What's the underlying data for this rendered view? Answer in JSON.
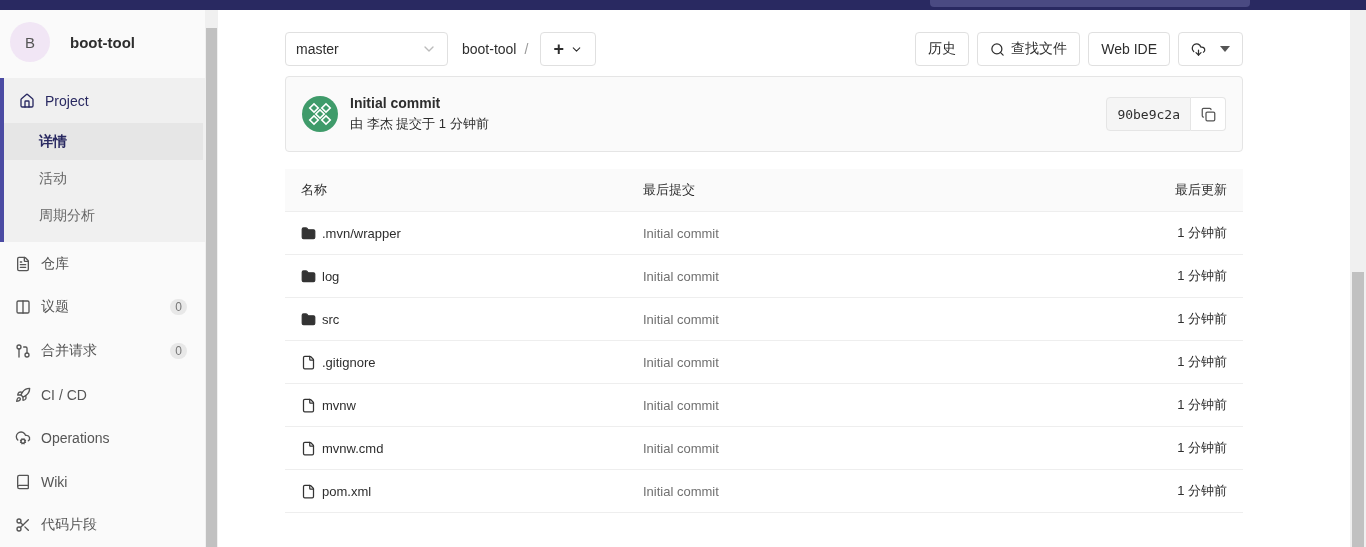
{
  "project": {
    "avatar": "B",
    "name": "boot-tool"
  },
  "sidebar": {
    "items": [
      {
        "label": "Project",
        "kind": "home",
        "children": [
          {
            "label": "详情",
            "selected": true
          },
          {
            "label": "活动",
            "selected": false
          },
          {
            "label": "周期分析",
            "selected": false
          }
        ]
      },
      {
        "label": "仓库",
        "kind": "doc"
      },
      {
        "label": "议题",
        "kind": "issue",
        "count": "0"
      },
      {
        "label": "合并请求",
        "kind": "merge",
        "count": "0"
      },
      {
        "label": "CI / CD",
        "kind": "rocket"
      },
      {
        "label": "Operations",
        "kind": "cloud"
      },
      {
        "label": "Wiki",
        "kind": "book"
      },
      {
        "label": "代码片段",
        "kind": "scissors"
      }
    ]
  },
  "toolbar": {
    "branch": "master",
    "path": "boot-tool",
    "separator": "/",
    "add": "+",
    "buttons": [
      {
        "kind": "text",
        "label": "历史"
      },
      {
        "kind": "search",
        "label": "查找文件"
      },
      {
        "kind": "text",
        "label": "Web IDE"
      },
      {
        "kind": "download"
      }
    ]
  },
  "commit": {
    "title": "Initial commit",
    "byline": "由 李杰 提交于 1 分钟前",
    "sha": "90be9c2a"
  },
  "table": {
    "columns": [
      "名称",
      "最后提交",
      "最后更新"
    ],
    "rows": [
      {
        "kind": "folder",
        "name": ".mvn/wrapper",
        "commit": "Initial commit",
        "updated": "1 分钟前"
      },
      {
        "kind": "folder",
        "name": "log",
        "commit": "Initial commit",
        "updated": "1 分钟前"
      },
      {
        "kind": "folder",
        "name": "src",
        "commit": "Initial commit",
        "updated": "1 分钟前"
      },
      {
        "kind": "file",
        "name": ".gitignore",
        "commit": "Initial commit",
        "updated": "1 分钟前"
      },
      {
        "kind": "file",
        "name": "mvnw",
        "commit": "Initial commit",
        "updated": "1 分钟前"
      },
      {
        "kind": "file",
        "name": "mvnw.cmd",
        "commit": "Initial commit",
        "updated": "1 分钟前"
      },
      {
        "kind": "file",
        "name": "pom.xml",
        "commit": "Initial commit",
        "updated": "1 分钟前"
      }
    ]
  }
}
